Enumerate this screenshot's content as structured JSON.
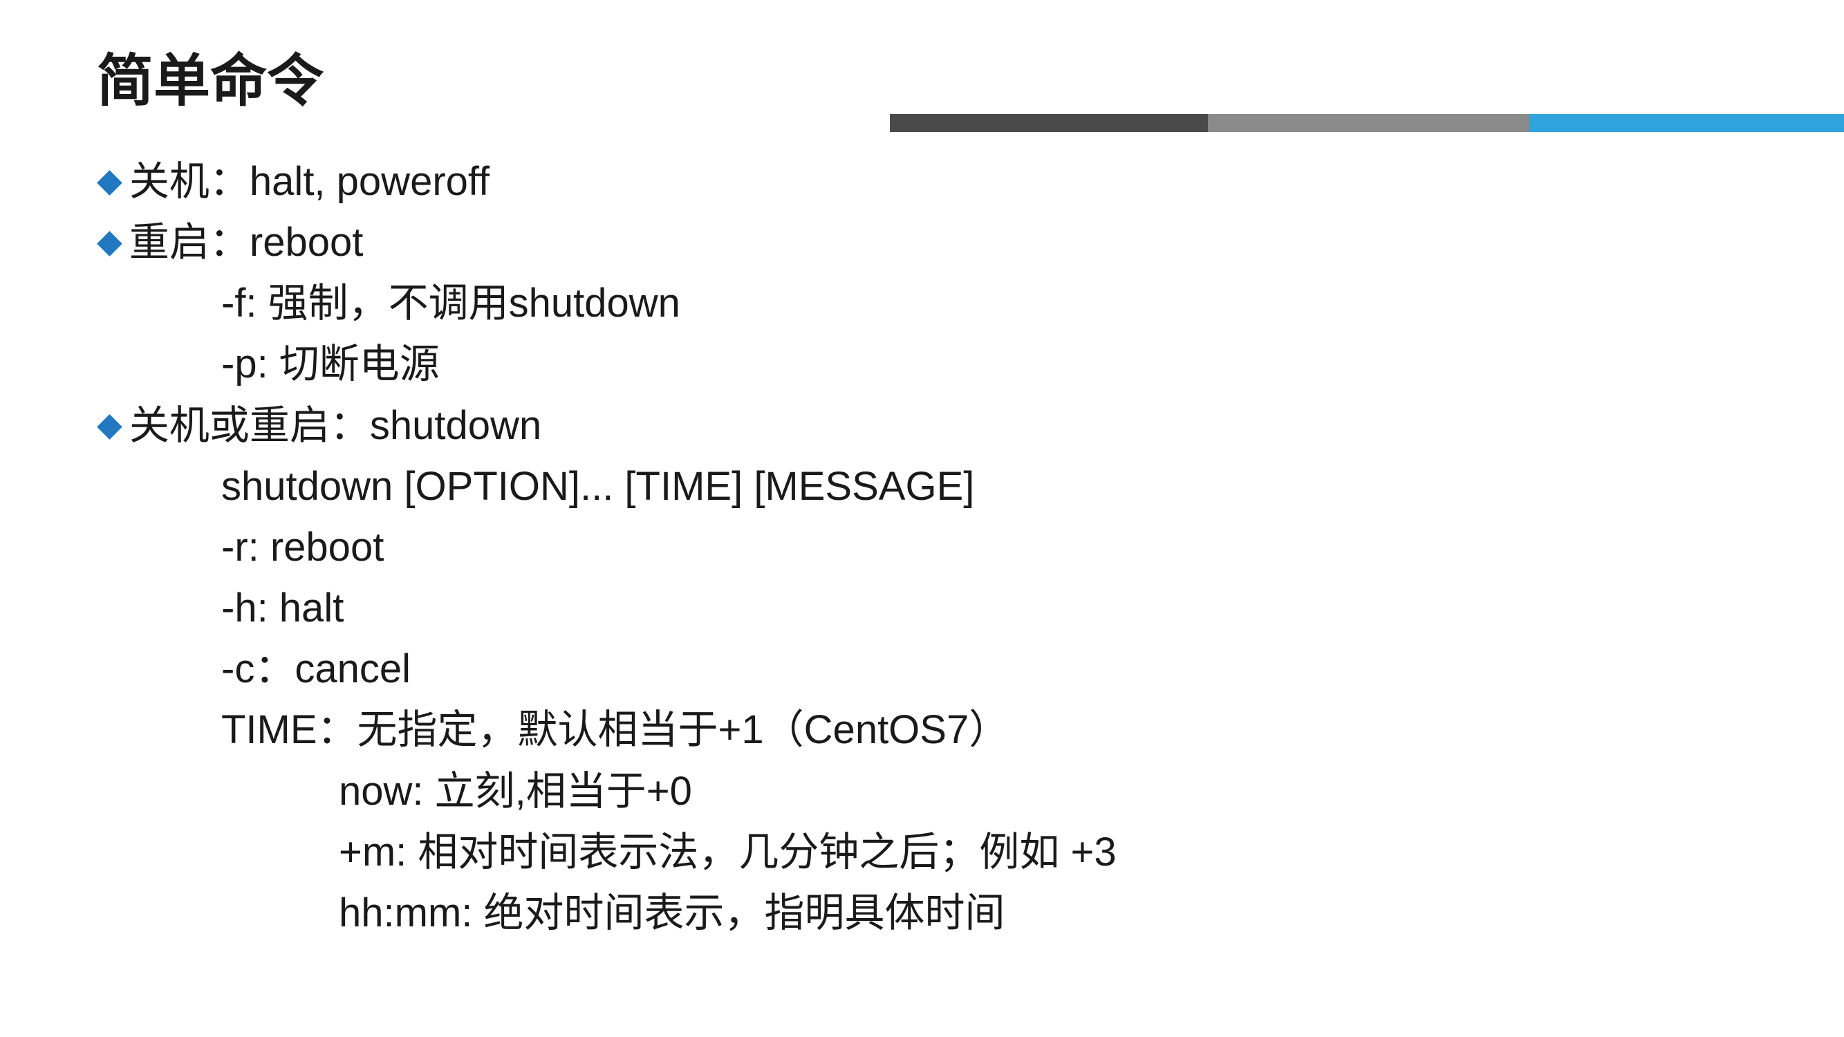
{
  "title": "简单命令",
  "bullets": {
    "b1": {
      "text": "关机：halt, poweroff"
    },
    "b2": {
      "text": "重启：reboot",
      "sub": {
        "s1": "-f: 强制，不调用shutdown",
        "s2": "-p: 切断电源"
      }
    },
    "b3": {
      "text": "关机或重启：shutdown",
      "sub": {
        "s1": "shutdown [OPTION]...  [TIME] [MESSAGE]",
        "s2": "-r: reboot",
        "s3": "-h: halt",
        "s4": "-c：cancel",
        "s5": "TIME：无指定，默认相当于+1（CentOS7）",
        "sub2": {
          "ss1": "now: 立刻,相当于+0",
          "ss2": "+m: 相对时间表示法，几分钟之后；例如 +3",
          "ss3": "hh:mm: 绝对时间表示，指明具体时间"
        }
      }
    }
  }
}
